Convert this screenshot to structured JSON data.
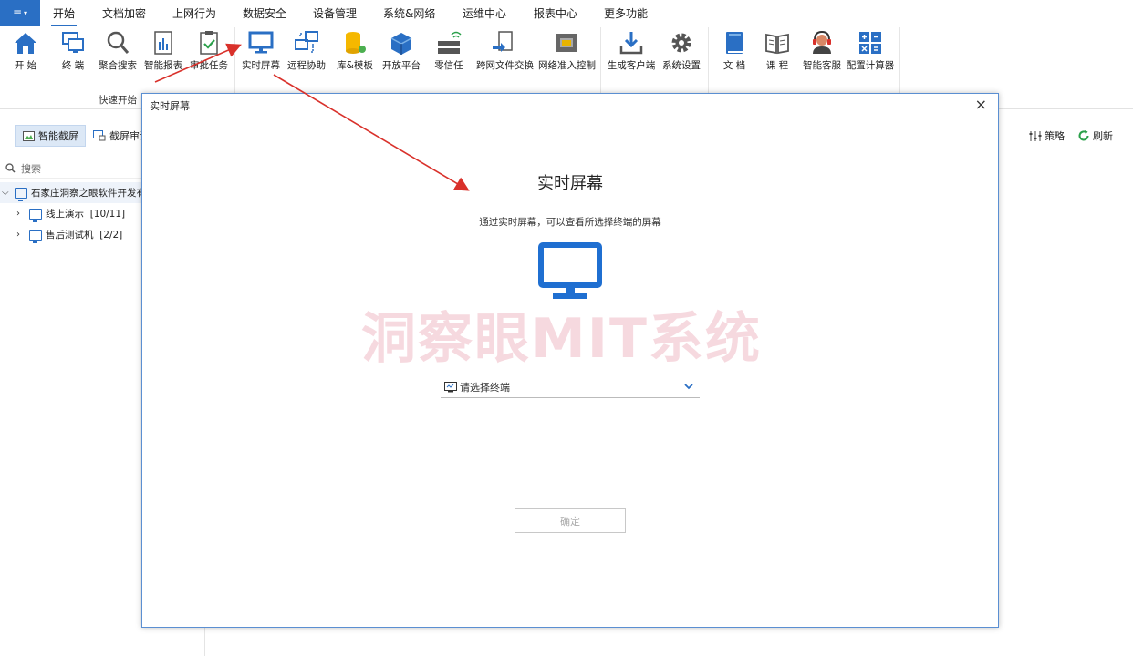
{
  "menubar": {
    "app_menu_glyph": "≡",
    "tabs": [
      "开始",
      "文档加密",
      "上网行为",
      "数据安全",
      "设备管理",
      "系统&网络",
      "运维中心",
      "报表中心",
      "更多功能"
    ]
  },
  "ribbon": {
    "items": [
      "开 始",
      "终 端",
      "聚合搜索",
      "智能报表",
      "审批任务",
      "实时屏幕",
      "远程协助",
      "库&模板",
      "开放平台",
      "零信任",
      "跨网文件交换",
      "网络准入控制",
      "生成客户端",
      "系统设置",
      "文 档",
      "课 程",
      "智能客服",
      "配置计算器"
    ],
    "group_label": "快速开始"
  },
  "toolbar": {
    "smart_screenshot": "智能截屏",
    "screenshot_audit": "截屏审计",
    "policy": "策略",
    "refresh": "刷新"
  },
  "sidebar": {
    "search_placeholder": "搜索",
    "tree": {
      "root": "石家庄洞察之眼软件开发有",
      "children": [
        {
          "label": "线上演示",
          "count": "[10/11]"
        },
        {
          "label": "售后测试机",
          "count": "[2/2]"
        }
      ]
    }
  },
  "modal": {
    "title": "实时屏幕",
    "heading": "实时屏幕",
    "description": "通过实时屏幕，可以查看所选择终端的屏幕",
    "watermark": "洞察眼MIT系统",
    "select_placeholder": "请选择终端",
    "ok_label": "确定",
    "close_glyph": "×"
  },
  "colors": {
    "accent": "#2a6fc4",
    "arrow": "#d9312b",
    "watermark": "#eeaabb"
  }
}
